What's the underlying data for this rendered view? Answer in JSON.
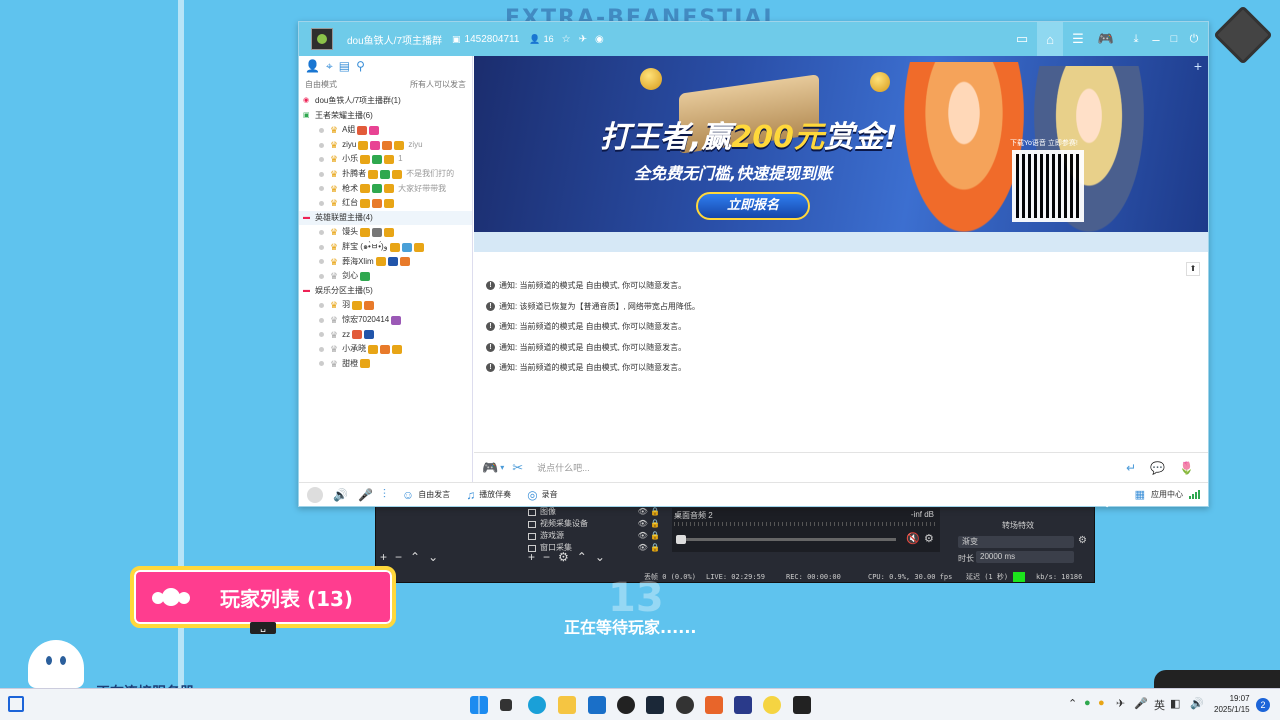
{
  "desktop": {
    "bg_title": "EXTRA-BEANESTIAL",
    "player_list_label": "玩家列表 (13)",
    "space_key_label": "␣",
    "big_number": "13",
    "waiting_text": "正在等待玩家......",
    "connecting_text": "正在连接服务器"
  },
  "obs": {
    "sources": [
      {
        "label": "图像"
      },
      {
        "label": "视频采集设备"
      },
      {
        "label": "游戏源"
      },
      {
        "label": "窗口采集"
      }
    ],
    "mixer_label": "桌面音频 2",
    "mixer_db": "-inf dB",
    "transition_title": "转场特效",
    "transition_value": "渐变",
    "duration_label": "时长",
    "duration_value": "20000 ms",
    "status": {
      "dropped": "丢帧 0 (0.0%)",
      "live": "LIVE: 02:29:59",
      "rec": "REC: 00:00:00",
      "cpu": "CPU: 0.9%, 30.00 fps",
      "delay": "延迟 (1 秒)",
      "kbps": "kb/s: 10186"
    }
  },
  "yy": {
    "title": {
      "channel_name": "dou鱼铁人/7项主播群",
      "channel_id": "1452804711",
      "user_count": "16"
    },
    "left": {
      "mode_label": "自由模式",
      "speak_label": "所有人可以发言",
      "tree": [
        {
          "type": "root",
          "text": "dou鱼铁人/7项主播群(1)"
        },
        {
          "type": "group",
          "text": "王者荣耀主播(6)",
          "mark": "green"
        },
        {
          "type": "member",
          "text": "A姐",
          "badges": [
            "#e25b3a",
            "#e84393"
          ]
        },
        {
          "type": "member",
          "text": "ziyu",
          "badges": [
            "#e8a516",
            "#e84393",
            "#e87a2a",
            "#e8a516"
          ],
          "note": "ziyu"
        },
        {
          "type": "member",
          "text": "小乐",
          "badges": [
            "#e8a516",
            "#2fa84f",
            "#e8a516"
          ],
          "note": "1"
        },
        {
          "type": "member",
          "text": "扑腾者",
          "badges": [
            "#e8a516",
            "#2fa84f",
            "#e8a516"
          ],
          "note": "不是我们打的"
        },
        {
          "type": "member",
          "text": "枪术",
          "badges": [
            "#e8a516",
            "#2fa84f",
            "#e8a516"
          ],
          "note": "大家好带带我"
        },
        {
          "type": "member",
          "text": "红台",
          "badges": [
            "#e8a516",
            "#e87a2a",
            "#e8a516"
          ]
        },
        {
          "type": "group",
          "text": "英雄联盟主播(4)",
          "mark": "red",
          "highlight": true
        },
        {
          "type": "member",
          "text": "馒头",
          "badges": [
            "#e8a516",
            "#777",
            "#e8a516"
          ]
        },
        {
          "type": "member",
          "text": "胖宝 (๑•̀ㅂ•́)و",
          "badges": [
            "#e8a516",
            "#4aa0d8",
            "#e8a516"
          ]
        },
        {
          "type": "member",
          "text": "葬海Xlim",
          "badges": [
            "#e8a516",
            "#2255aa",
            "#e87a2a"
          ]
        },
        {
          "type": "member",
          "text": "剑心",
          "badges": [
            "#2fa84f"
          ],
          "grey": true
        },
        {
          "type": "group",
          "text": "娱乐分区主播(5)",
          "mark": "red"
        },
        {
          "type": "member",
          "text": "羽",
          "badges": [
            "#e8a516",
            "#e87a2a"
          ]
        },
        {
          "type": "member",
          "text": "惊宏7020414",
          "badges": [
            "#9b59b6"
          ],
          "grey": true
        },
        {
          "type": "member",
          "text": "zz",
          "badges": [
            "#e25b3a",
            "#2255aa"
          ],
          "grey": true
        },
        {
          "type": "member",
          "text": "小承晓",
          "badges": [
            "#e8a516",
            "#e87a2a",
            "#e8a516"
          ],
          "grey": true
        },
        {
          "type": "member",
          "text": "甜橙",
          "badges": [
            "#e8a516"
          ],
          "grey": true
        }
      ]
    },
    "banner": {
      "headline_a": "打王者,赢",
      "headline_amount": "200元",
      "headline_b": "赏金!",
      "subline": "全免费无门槛,快速提现到账",
      "cta": "立即报名",
      "qr_caption": "下载Yo语音 立即参赛!"
    },
    "messages": [
      "通知: 当前频道的模式是 自由模式, 你可以随意发言。",
      "通知: 该频道已恢复为【普通音质】, 网络带宽占用降低。",
      "通知: 当前频道的模式是 自由模式, 你可以随意发言。",
      "通知: 当前频道的模式是 自由模式, 你可以随意发言。",
      "通知: 当前频道的模式是 自由模式, 你可以随意发言。"
    ],
    "input_placeholder": "说点什么吧...",
    "bottom": {
      "free_speak": "自由发言",
      "accompany": "播放伴奏",
      "record": "录音",
      "app_center": "应用中心"
    }
  },
  "taskbar": {
    "time": "19:07",
    "date": "2025/1/15",
    "ime": "英",
    "notification_count": "2"
  }
}
